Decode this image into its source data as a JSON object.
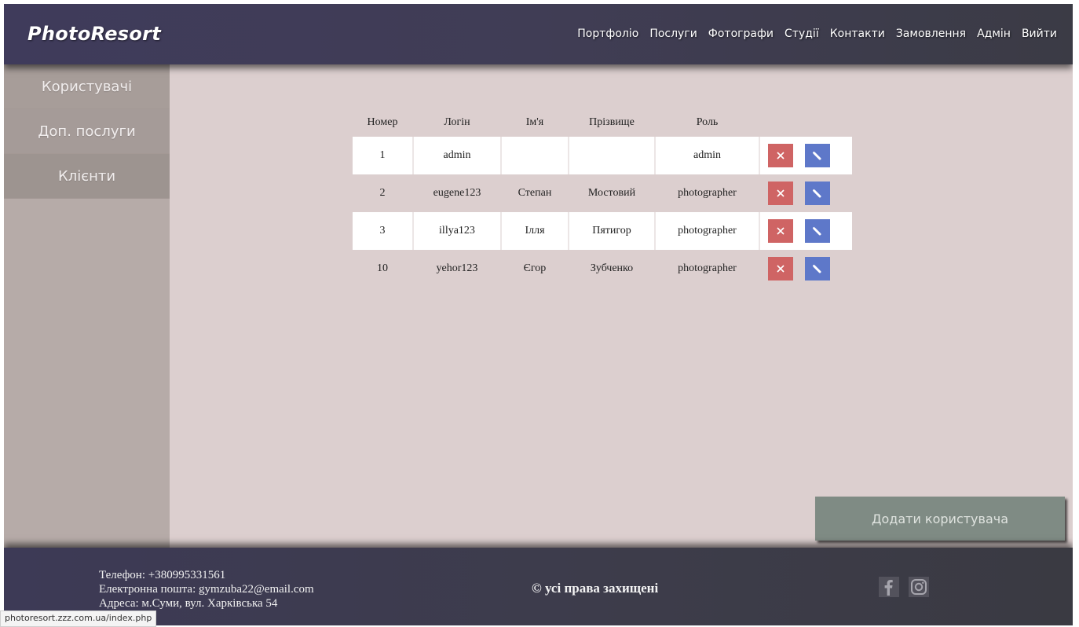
{
  "header": {
    "logo": "PhotoResort",
    "nav": [
      "Портфоліо",
      "Послуги",
      "Фотографи",
      "Студії",
      "Контакти",
      "Замовлення",
      "Адмін",
      "Вийти"
    ]
  },
  "sidebar": {
    "items": [
      {
        "label": "Користувачі"
      },
      {
        "label": "Доп. послуги"
      },
      {
        "label": "Клієнти"
      }
    ]
  },
  "table": {
    "headers": [
      "Номер",
      "Логін",
      "Ім'я",
      "Прізвище",
      "Роль"
    ],
    "rows": [
      [
        "1",
        "admin",
        "",
        "",
        "admin"
      ],
      [
        "2",
        "eugene123",
        "Степан",
        "Мостовий",
        "photographer"
      ],
      [
        "3",
        "illya123",
        "Ілля",
        "Пятигор",
        "photographer"
      ],
      [
        "10",
        "yehor123",
        "Єгор",
        "Зубченко",
        "photographer"
      ]
    ]
  },
  "actions": {
    "add_user": "Додати користувача",
    "delete_icon": "close-icon",
    "edit_icon": "pencil-icon"
  },
  "footer": {
    "phone": "Телефон: +380995331561",
    "email": "Електронна пошта: gymzuba22@email.com",
    "address": "Адреса: м.Суми, вул. Харківська 54",
    "copyright": "© усі права захищені",
    "social": [
      "facebook-icon",
      "instagram-icon"
    ]
  },
  "status_url": "photoresort.zzz.com.ua/index.php",
  "colors": {
    "header_bg": "#3f3b5b",
    "page_bg": "#dccfcf",
    "sidebar_bg": "#b6aba8",
    "delete_btn": "#cf6464",
    "edit_btn": "#5e78c9",
    "add_btn": "#7f8b84"
  }
}
